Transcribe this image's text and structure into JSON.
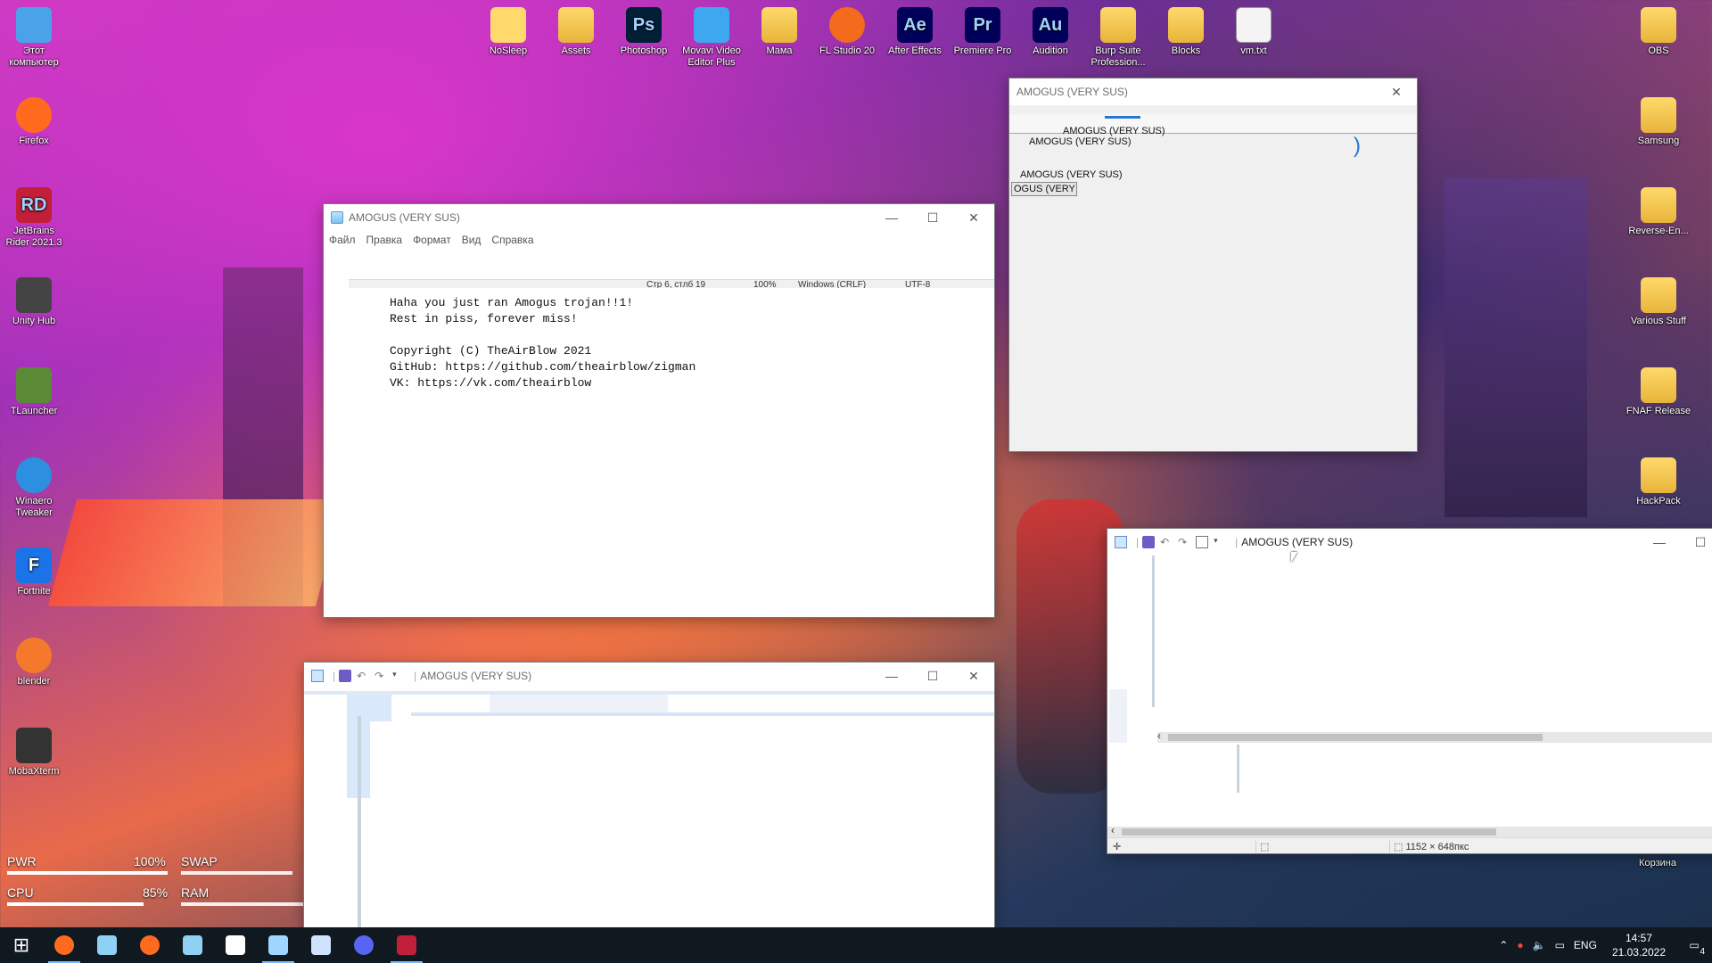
{
  "desktop": {
    "icons_left": [
      {
        "label": "Этот компьютер",
        "icon": "computer-icon",
        "color": "#4aa3e8"
      },
      {
        "label": "Firefox",
        "icon": "firefox-icon",
        "color": "#ff6a1f"
      },
      {
        "label": "JetBrains Rider 2021.3",
        "icon": "rider-icon",
        "color": "#c21f3a",
        "glyph": "RD"
      },
      {
        "label": "Unity Hub",
        "icon": "unity-icon",
        "color": "#444444"
      },
      {
        "label": "TLauncher",
        "icon": "minecraft-icon",
        "color": "#5b8a36"
      },
      {
        "label": "Winaero Tweaker",
        "icon": "winaero-icon",
        "color": "#2c8fe0"
      },
      {
        "label": "Fortnite",
        "icon": "fortnite-icon",
        "color": "#1b73e8",
        "glyph": "F"
      },
      {
        "label": "blender",
        "icon": "blender-icon",
        "color": "#f5792a"
      },
      {
        "label": "MobaXterm",
        "icon": "mobaxterm-icon",
        "color": "#333333"
      }
    ],
    "icons_top": [
      {
        "label": "NoSleep",
        "icon": "nosleep-icon",
        "color": "#ffd96b"
      },
      {
        "label": "Assets",
        "icon": "folder-icon",
        "color": "#ffd96b"
      },
      {
        "label": "Photoshop",
        "icon": "photoshop-icon",
        "color": "#001e36",
        "glyph": "Ps"
      },
      {
        "label": "Movavi Video Editor Plus",
        "icon": "movavi-icon",
        "color": "#3da7f0"
      },
      {
        "label": "Мама",
        "icon": "folder-icon",
        "color": "#ffd96b"
      },
      {
        "label": "FL Studio 20",
        "icon": "flstudio-icon",
        "color": "#f46b1e"
      },
      {
        "label": "After Effects",
        "icon": "aftereffects-icon",
        "color": "#00005b",
        "glyph": "Ae"
      },
      {
        "label": "Premiere Pro",
        "icon": "premiere-icon",
        "color": "#00005b",
        "glyph": "Pr"
      },
      {
        "label": "Audition",
        "icon": "audition-icon",
        "color": "#00005b",
        "glyph": "Au"
      },
      {
        "label": "Burp Suite Profession...",
        "icon": "folder-icon",
        "color": "#ffd96b"
      },
      {
        "label": "Blocks",
        "icon": "folder-icon",
        "color": "#ffd96b"
      },
      {
        "label": "vm.txt",
        "icon": "text-file-icon",
        "color": "#f4f4f4"
      }
    ],
    "icons_right": [
      {
        "label": "OBS",
        "icon": "folder-icon"
      },
      {
        "label": "Samsung",
        "icon": "folder-icon"
      },
      {
        "label": "Reverse-En...",
        "icon": "folder-icon"
      },
      {
        "label": "Various Stuff",
        "icon": "folder-icon"
      },
      {
        "label": "FNAF Release",
        "icon": "folder-icon"
      },
      {
        "label": "HackPack",
        "icon": "folder-icon"
      }
    ],
    "recycle_bin": "Корзина"
  },
  "monitor": {
    "pwr_label": "PWR",
    "pwr_value": "100%",
    "pwr_level": 1.0,
    "swap_label": "SWAP",
    "cpu_label": "CPU",
    "cpu_value": "85%",
    "cpu_level": 0.85,
    "ram_label": "RAM"
  },
  "notepad": {
    "title": "AMOGUS (VERY SUS)",
    "menu": [
      "Файл",
      "Правка",
      "Формат",
      "Вид",
      "Справка"
    ],
    "status": {
      "position": "Стр 6, стлб 19",
      "zoom": "100%",
      "eol": "Windows (CRLF)",
      "encoding": "UTF-8"
    },
    "lines": [
      "Haha you just ran Amogus trojan!!1!",
      "Rest in piss, forever miss!",
      "",
      "Copyright (C) TheAirBlow 2021",
      "GitHub: https://github.com/theairblow/zigman",
      "VK: https://vk.com/theairblow"
    ]
  },
  "dialog": {
    "title": "AMOGUS (VERY SUS)",
    "glitch_labels": [
      "AMOGUS (VERY SUS)",
      "AMOGUS (VERY SUS)",
      "AMOGUS (VERY SUS)",
      "OGUS (VERY SI"
    ]
  },
  "paint_bottom": {
    "title": "AMOGUS (VERY SUS)"
  },
  "paint_right": {
    "title": "AMOGUS (VERY SUS)",
    "canvas_size": "1152 × 648пкс"
  },
  "taskbar": {
    "apps": [
      {
        "name": "start-button",
        "icon": "windows-icon",
        "color": "#ffffff"
      },
      {
        "name": "firefox-taskbar",
        "icon": "firefox-icon",
        "color": "#ff6a1f",
        "active": true
      },
      {
        "name": "notepad-taskbar-1",
        "icon": "notepad-icon",
        "color": "#8fd0f5"
      },
      {
        "name": "firefox-taskbar-2",
        "icon": "firefox-icon",
        "color": "#ff6a1f"
      },
      {
        "name": "notepad-taskbar-2",
        "icon": "notepad-icon",
        "color": "#8fd0f5"
      },
      {
        "name": "terminal-taskbar",
        "icon": "terminal-icon",
        "color": "#ffffff"
      },
      {
        "name": "paint-taskbar",
        "icon": "paint-icon",
        "color": "#9fd6ff",
        "active": true
      },
      {
        "name": "explorer-taskbar",
        "icon": "explorer-icon",
        "color": "#cfe3ff"
      },
      {
        "name": "discord-taskbar",
        "icon": "discord-icon",
        "color": "#5865f2"
      },
      {
        "name": "rider-taskbar",
        "icon": "rider-icon",
        "color": "#c21f3a",
        "active": true
      }
    ],
    "tray": {
      "lang": "ENG",
      "time": "14:57",
      "date": "21.03.2022",
      "notifications": "4"
    }
  }
}
